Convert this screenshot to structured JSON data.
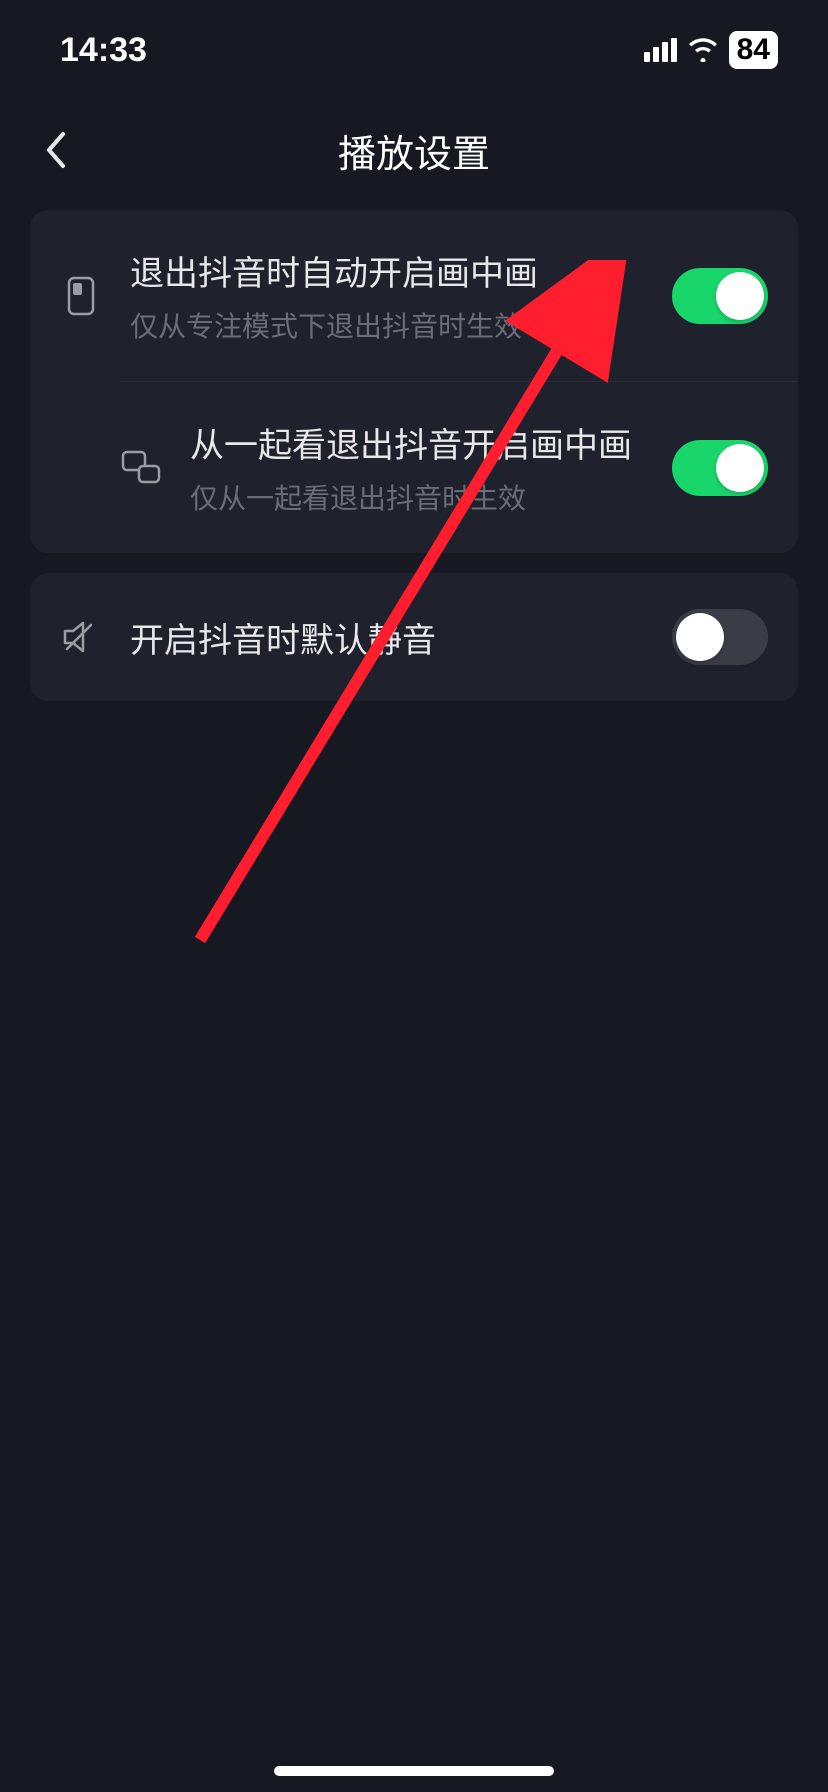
{
  "statusBar": {
    "time": "14:33",
    "battery": "84"
  },
  "nav": {
    "title": "播放设置"
  },
  "settings": {
    "group1": [
      {
        "title": "退出抖音时自动开启画中画",
        "subtitle": "仅从专注模式下退出抖音时生效",
        "toggle": true
      },
      {
        "title": "从一起看退出抖音开启画中画",
        "subtitle": "仅从一起看退出抖音时生效",
        "toggle": true
      }
    ],
    "group2": [
      {
        "title": "开启抖音时默认静音",
        "toggle": false
      }
    ]
  }
}
